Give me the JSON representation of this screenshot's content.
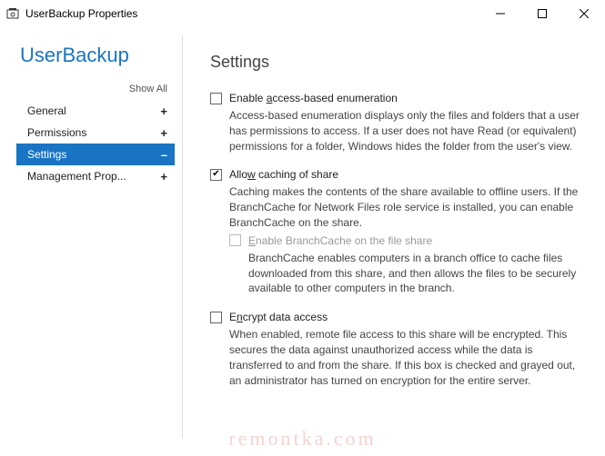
{
  "window": {
    "title": "UserBackup Properties"
  },
  "heading": "UserBackup",
  "show_all": "Show All",
  "nav": {
    "items": [
      {
        "label": "General",
        "expander": "+",
        "selected": false
      },
      {
        "label": "Permissions",
        "expander": "+",
        "selected": false
      },
      {
        "label": "Settings",
        "expander": "–",
        "selected": true
      },
      {
        "label": "Management Prop...",
        "expander": "+",
        "selected": false
      }
    ]
  },
  "content": {
    "heading": "Settings",
    "settings": [
      {
        "key": "enable_abe",
        "label_pre": "Enable ",
        "label_u": "a",
        "label_post": "ccess-based enumeration",
        "checked": false,
        "disabled": false,
        "desc": "Access-based enumeration displays only the files and folders that a user has permissions to access. If a user does not have Read (or equivalent) permissions for a folder, Windows hides the folder from the user's view."
      },
      {
        "key": "allow_caching",
        "label_pre": "Allo",
        "label_u": "w",
        "label_post": " caching of share",
        "checked": true,
        "disabled": false,
        "desc": "Caching makes the contents of the share available to offline users. If the BranchCache for Network Files role service is installed, you can enable BranchCache on the share.",
        "child": {
          "key": "enable_branchcache",
          "label_pre": "",
          "label_u": "E",
          "label_post": "nable BranchCache on the file share",
          "checked": false,
          "disabled": true,
          "desc": "BranchCache enables computers in a branch office to cache files downloaded from this share, and then allows the files to be securely available to other computers in the branch."
        }
      },
      {
        "key": "encrypt",
        "label_pre": "E",
        "label_u": "n",
        "label_post": "crypt data access",
        "checked": false,
        "disabled": false,
        "desc": "When enabled, remote file access to this share will be encrypted. This secures the data against unauthorized access while the data is transferred to and from the share. If this box is checked and grayed out, an administrator has turned on encryption for the entire server."
      }
    ]
  },
  "watermark": "remontka.com"
}
